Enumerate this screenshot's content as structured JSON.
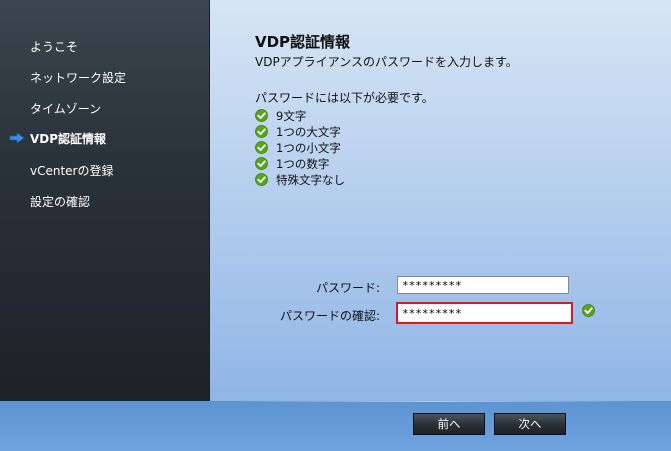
{
  "sidebar": {
    "items": [
      {
        "label": "ようこそ",
        "active": false
      },
      {
        "label": "ネットワーク設定",
        "active": false
      },
      {
        "label": "タイムゾーン",
        "active": false
      },
      {
        "label": "VDP認証情報",
        "active": true
      },
      {
        "label": "vCenterの登録",
        "active": false
      },
      {
        "label": "設定の確認",
        "active": false
      }
    ],
    "active_indicator_icon": "arrow-right-icon"
  },
  "main": {
    "title": "VDP認証情報",
    "subtitle": "VDPアプライアンスのパスワードを入力します。",
    "requirements_heading": "パスワードには以下が必要です。",
    "requirements": [
      {
        "label": "9文字",
        "satisfied": true,
        "icon": "check-icon"
      },
      {
        "label": "1つの大文字",
        "satisfied": true,
        "icon": "check-icon"
      },
      {
        "label": "1つの小文字",
        "satisfied": true,
        "icon": "check-icon"
      },
      {
        "label": "1つの数字",
        "satisfied": true,
        "icon": "check-icon"
      },
      {
        "label": "特殊文字なし",
        "satisfied": true,
        "icon": "check-icon"
      }
    ],
    "password": {
      "label": "パスワード:",
      "value": "*********"
    },
    "confirm_password": {
      "label": "パスワードの確認:",
      "value": "*********",
      "error_border_color": "#e0161b",
      "status_icon": "check-icon"
    }
  },
  "footer": {
    "back_label": "前へ",
    "next_label": "次へ"
  },
  "colors": {
    "check_green": "#5aa51e",
    "arrow_blue": "#3f8fe0",
    "error_red": "#e0161b"
  }
}
